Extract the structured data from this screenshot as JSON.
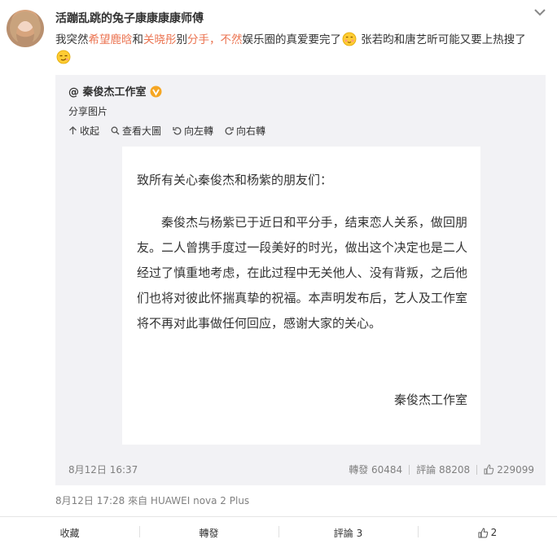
{
  "post": {
    "author": "活蹦乱跳的兔子康康康康师傅",
    "text_parts": {
      "p1": "我突然",
      "h1": "希望鹿晗",
      "p2": "和",
      "h2": "关晓彤",
      "p3": "别",
      "h3": "分手，",
      "h4": "不然",
      "p4": "娱乐圈的真爱要完了",
      "p5": " 张若昀和唐艺昕可能又要上热搜了"
    },
    "meta": "8月12日 17:28 來自 HUAWEI nova 2 Plus",
    "accent_color": "#eb7350"
  },
  "repost": {
    "origin_author": "@ 秦俊杰工作室",
    "verified_badge_color": "#f5a623",
    "share_label": "分享图片",
    "image_tools": {
      "collapse": "收起",
      "view_large": "查看大圖",
      "rotate_left": "向左轉",
      "rotate_right": "向右轉"
    },
    "letter": {
      "greeting": "致所有关心秦俊杰和杨紫的朋友们：",
      "body": "秦俊杰与杨紫已于近日和平分手，结束恋人关系，做回朋友。二人曾携手度过一段美好的时光，做出这个决定也是二人经过了慎重地考虑，在此过程中无关他人、没有背叛，之后他们也将对彼此怀揣真挚的祝福。本声明发布后，艺人及工作室将不再对此事做任何回应，感谢大家的关心。",
      "signature": "秦俊杰工作室"
    },
    "date": "8月12日 16:37",
    "repost_count": "轉發 60484",
    "comment_count": "評論 88208",
    "like_count": "229099"
  },
  "actions": {
    "favorite": "收藏",
    "repost": "轉發",
    "comment": "評論 3",
    "like": "2"
  }
}
